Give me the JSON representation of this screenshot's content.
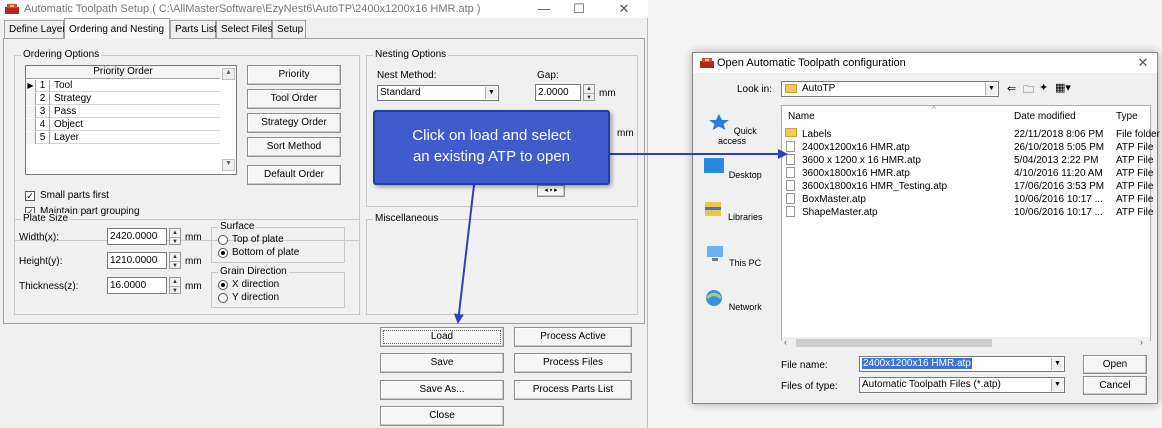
{
  "main_window": {
    "title": "Automatic Toolpath Setup ( C:\\AllMasterSoftware\\EzyNest6\\AutoTP\\2400x1200x16 HMR.atp )",
    "controls": {
      "minimize": "—",
      "maximize": "☐",
      "close": "✕"
    },
    "tabs": [
      "Define Layers",
      "Ordering and Nesting",
      "Parts List",
      "Select Files",
      "Setup"
    ],
    "ordering": {
      "group_label": "Ordering Options",
      "grid_header": "Priority Order",
      "rows": [
        {
          "num": "1",
          "name": "Tool"
        },
        {
          "num": "2",
          "name": "Strategy"
        },
        {
          "num": "3",
          "name": "Pass"
        },
        {
          "num": "4",
          "name": "Object"
        },
        {
          "num": "5",
          "name": "Layer"
        }
      ],
      "buttons": [
        "Priority",
        "Tool Order",
        "Strategy Order",
        "Sort Method",
        "Default Order"
      ],
      "checkboxes": [
        {
          "label": "Small parts first",
          "checked": true
        },
        {
          "label": "Maintain part grouping",
          "checked": true
        }
      ]
    },
    "nesting": {
      "group_label": "Nesting Options",
      "method_label": "Nest Method:",
      "method_value": "Standard",
      "gap_label": "Gap:",
      "gap_value": "2.0000",
      "gap_unit": "mm",
      "second_unit": "mm"
    },
    "plate": {
      "group_label": "Plate Size",
      "fields": [
        {
          "label": "Width(x):",
          "value": "2420.0000",
          "unit": "mm"
        },
        {
          "label": "Height(y):",
          "value": "1210.0000",
          "unit": "mm"
        },
        {
          "label": "Thickness(z):",
          "value": "16.0000",
          "unit": "mm"
        }
      ],
      "surface": {
        "group_label": "Surface",
        "options": [
          {
            "label": "Top of plate",
            "selected": false
          },
          {
            "label": "Bottom of plate",
            "selected": true
          }
        ]
      },
      "grain": {
        "group_label": "Grain Direction",
        "options": [
          {
            "label": "X direction",
            "selected": true
          },
          {
            "label": "Y direction",
            "selected": false
          }
        ]
      }
    },
    "misc_label": "Miscellaneous",
    "bottom_buttons": {
      "left": [
        "Load",
        "Save",
        "Save As...",
        "Close"
      ],
      "right": [
        "Process Active",
        "Process Files",
        "Process Parts List"
      ]
    }
  },
  "callout": {
    "line1": "Click on load and select",
    "line2": "an existing ATP to open",
    "color": "#3f5bcc"
  },
  "dialog": {
    "title": "Open Automatic Toolpath configuration",
    "close": "✕",
    "look_in_label": "Look in:",
    "look_in_value": "AutoTP",
    "sidebar": [
      "Quick access",
      "Desktop",
      "Libraries",
      "This PC",
      "Network"
    ],
    "columns": [
      "Name",
      "Date modified",
      "Type"
    ],
    "files": [
      {
        "name": "Labels",
        "date": "22/11/2018 8:06 PM",
        "type": "File folder",
        "folder": true
      },
      {
        "name": "2400x1200x16 HMR.atp",
        "date": "26/10/2018 5:05 PM",
        "type": "ATP File",
        "folder": false
      },
      {
        "name": "3600 x 1200 x 16 HMR.atp",
        "date": "5/04/2013 2:22 PM",
        "type": "ATP File",
        "folder": false
      },
      {
        "name": "3600x1800x16 HMR.atp",
        "date": "4/10/2016 11:20 AM",
        "type": "ATP File",
        "folder": false
      },
      {
        "name": "3600x1800x16 HMR_Testing.atp",
        "date": "17/06/2016 3:53 PM",
        "type": "ATP File",
        "folder": false
      },
      {
        "name": "BoxMaster.atp",
        "date": "10/06/2016 10:17 ...",
        "type": "ATP File",
        "folder": false
      },
      {
        "name": "ShapeMaster.atp",
        "date": "10/06/2016 10:17 ...",
        "type": "ATP File",
        "folder": false
      }
    ],
    "file_name_label": "File name:",
    "file_name_value": "2400x1200x16 HMR.atp",
    "file_type_label": "Files of type:",
    "file_type_value": "Automatic Toolpath Files (*.atp)",
    "open_label": "Open",
    "cancel_label": "Cancel"
  }
}
